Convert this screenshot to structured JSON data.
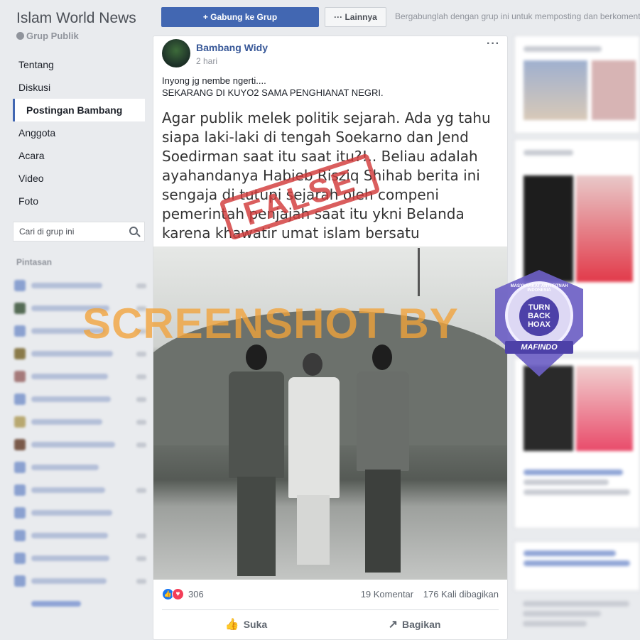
{
  "group": {
    "name": "Islam World News",
    "type": "Grup Publik"
  },
  "nav": [
    {
      "label": "Tentang"
    },
    {
      "label": "Diskusi"
    },
    {
      "label": "Postingan Bambang",
      "active": true
    },
    {
      "label": "Anggota"
    },
    {
      "label": "Acara"
    },
    {
      "label": "Video"
    },
    {
      "label": "Foto"
    }
  ],
  "search": {
    "placeholder": "Cari di grup ini"
  },
  "shortcuts": {
    "title": "Pintasan"
  },
  "topbar": {
    "join_label": "+ Gabung ke Grup",
    "more_label": "··· Lainnya",
    "hint": "Bergabunglah dengan grup ini untuk memposting dan berkomentar."
  },
  "post": {
    "author": "Bambang Widy",
    "time": "2 hari",
    "text_line1": "Inyong jg nembe ngerti....",
    "text_line2": "SEKARANG DI KUYO2 SAMA PENGHIANAT NEGRI.",
    "image": {
      "caption_lines": [
        "Agar publik melek politik sejarah. Ada yg tahu",
        "siapa laki-laki di tengah Soekarno dan Jend",
        "Soedirman saat itu saat itu?!.. Beliau adalah",
        "ayahandanya Habieb Risziq Shihab berita ini",
        "sengaja di tutupi sejarah oleh compeni",
        "pemerintah penjajah saat itu ykni  Belanda",
        "karena khawatir umat islam bersatu"
      ],
      "stamp": "FALSE",
      "watermark": "SCREENSHOT BY"
    },
    "reactions_count": "306",
    "comments": "19 Komentar",
    "shares": "176 Kali dibagikan",
    "like_label": "Suka",
    "share_label": "Bagikan"
  },
  "badge": {
    "arc_text": "MASYARAKAT ANTI FITNAH INDONESIA",
    "center_text": "TURN BACK HOAX",
    "ribbon": "MAFINDO"
  },
  "colors": {
    "brand": "#4267b2",
    "link": "#385898",
    "stamp": "#d23b3b",
    "watermark": "#f2a33a",
    "badge": "#6c5fc4"
  }
}
